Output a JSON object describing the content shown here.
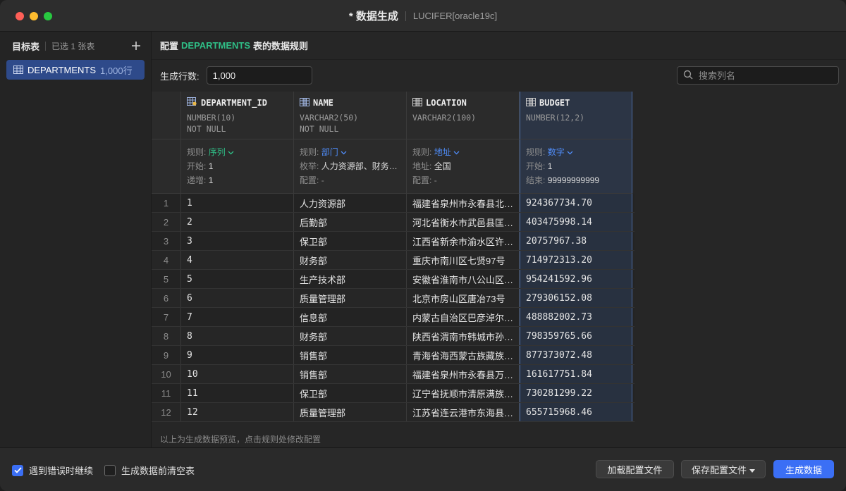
{
  "window": {
    "title": "* 数据生成",
    "connection": "LUCIFER[oracle19c]"
  },
  "sidebar": {
    "title": "目标表",
    "selected_count": "已选 1 张表",
    "add_icon": "plus-icon",
    "tables": [
      {
        "name": "DEPARTMENTS",
        "rows": "1,000行"
      }
    ]
  },
  "config": {
    "prefix": "配置",
    "table": "DEPARTMENTS",
    "suffix": "表的数据规则",
    "rows_label": "生成行数:",
    "rows_value": "1,000",
    "search_placeholder": "搜索列名"
  },
  "columns": [
    {
      "name": "DEPARTMENT_ID",
      "type": "NUMBER(10)",
      "constraint": "NOT NULL",
      "icon": "primary-key-column-icon",
      "rule_label": "规则:",
      "rule": "序列",
      "rule_color": "#2fbf87",
      "p1_label": "开始:",
      "p1_value": "1",
      "p2_label": "递增:",
      "p2_value": "1"
    },
    {
      "name": "NAME",
      "type": "VARCHAR2(50)",
      "constraint": "NOT NULL",
      "icon": "column-icon",
      "rule_label": "规则:",
      "rule": "部门",
      "rule_color": "#4f8cf7",
      "p1_label": "枚举:",
      "p1_value": "人力资源部、财务…",
      "p2_label": "配置:",
      "p2_value": "-"
    },
    {
      "name": "LOCATION",
      "type": "VARCHAR2(100)",
      "constraint": "",
      "icon": "column-icon",
      "rule_label": "规则:",
      "rule": "地址",
      "rule_color": "#4f8cf7",
      "p1_label": "地址:",
      "p1_value": "全国",
      "p2_label": "配置:",
      "p2_value": "-"
    },
    {
      "name": "BUDGET",
      "type": "NUMBER(12,2)",
      "constraint": "",
      "icon": "column-icon",
      "rule_label": "规则:",
      "rule": "数字",
      "rule_color": "#4f8cf7",
      "p1_label": "开始:",
      "p1_value": "1",
      "p2_label": "结束:",
      "p2_value": "99999999999"
    }
  ],
  "rows": [
    [
      "1",
      "1",
      "人力资源部",
      "福建省泉州市永春县北…",
      "924367734.70"
    ],
    [
      "2",
      "2",
      "后勤部",
      "河北省衡水市武邑县匡…",
      "403475998.14"
    ],
    [
      "3",
      "3",
      "保卫部",
      "江西省新余市渝水区许…",
      "20757967.38"
    ],
    [
      "4",
      "4",
      "财务部",
      "重庆市南川区七贤97号",
      "714972313.20"
    ],
    [
      "5",
      "5",
      "生产技术部",
      "安徽省淮南市八公山区…",
      "954241592.96"
    ],
    [
      "6",
      "6",
      "质量管理部",
      "北京市房山区唐冶73号",
      "279306152.08"
    ],
    [
      "7",
      "7",
      "信息部",
      "内蒙古自治区巴彦淖尔…",
      "488882002.73"
    ],
    [
      "8",
      "8",
      "财务部",
      "陕西省渭南市韩城市孙…",
      "798359765.66"
    ],
    [
      "9",
      "9",
      "销售部",
      "青海省海西蒙古族藏族…",
      "877373072.48"
    ],
    [
      "10",
      "10",
      "销售部",
      "福建省泉州市永春县万…",
      "161617751.84"
    ],
    [
      "11",
      "11",
      "保卫部",
      "辽宁省抚顺市清原满族…",
      "730281299.22"
    ],
    [
      "12",
      "12",
      "质量管理部",
      "江苏省连云港市东海县…",
      "655715968.46"
    ]
  ],
  "hint": "以上为生成数据预览，点击规则处修改配置",
  "footer": {
    "continue_on_error": {
      "label": "遇到错误时继续",
      "checked": true
    },
    "truncate_before": {
      "label": "生成数据前清空表",
      "checked": false
    },
    "load_config": "加载配置文件",
    "save_config": "保存配置文件",
    "generate": "生成数据"
  },
  "colors": {
    "accent": "#3b6ff5",
    "table_name": "#2fbf87",
    "rule_link": "#4f8cf7",
    "sidebar_selected": "#2e4a8a"
  }
}
